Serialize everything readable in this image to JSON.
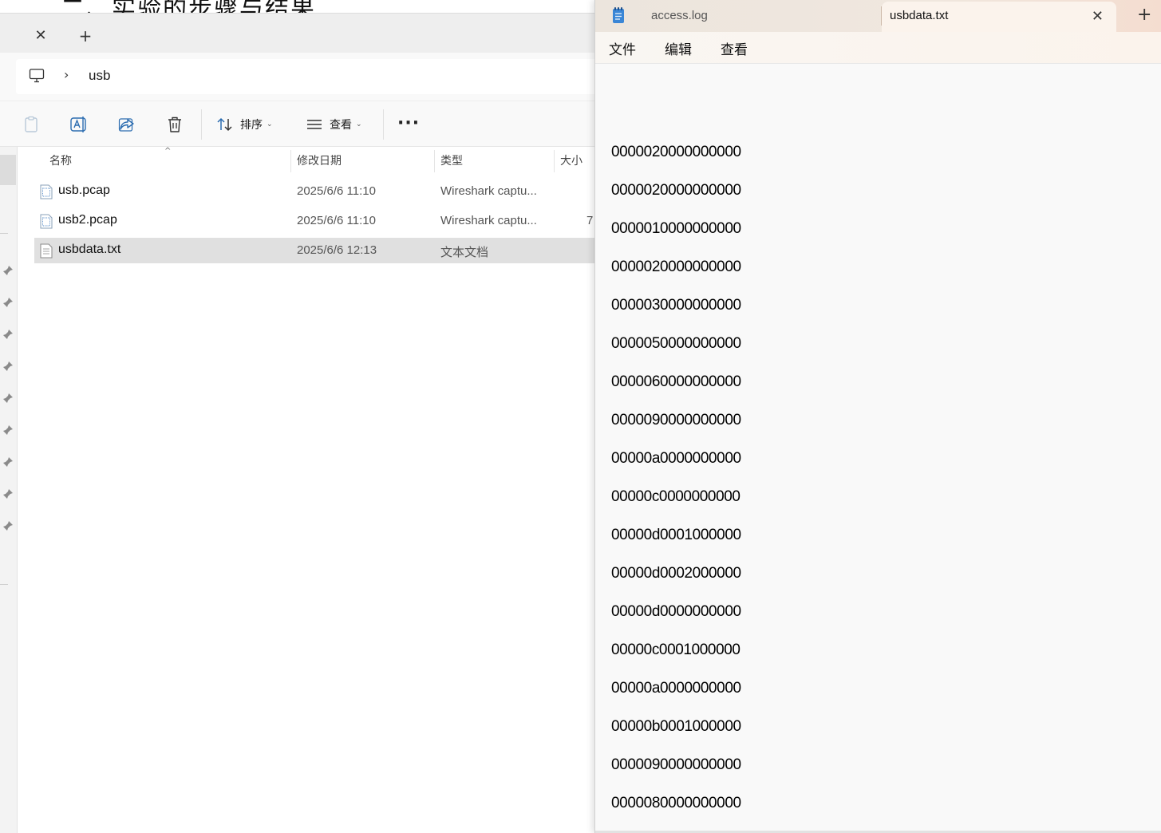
{
  "background_doc": {
    "heading_fragment": "二、实验的步骤与结果"
  },
  "explorer": {
    "tab_close_icon": "close-icon",
    "tab_new_icon": "plus-icon",
    "address": {
      "root_icon": "computer-icon",
      "separator": "›",
      "path_segment": "usb"
    },
    "toolbar": {
      "sort_label": "排序",
      "view_label": "查看",
      "more_label": "···",
      "icons": [
        "paste-icon",
        "rename-icon",
        "share-icon",
        "delete-icon",
        "sort-icon",
        "view-icon",
        "more-icon"
      ]
    },
    "columns": {
      "name": "名称",
      "date": "修改日期",
      "type": "类型",
      "size": "大小"
    },
    "files": [
      {
        "name": "usb.pcap",
        "date": "2025/6/6 11:10",
        "type": "Wireshark captu...",
        "size": "",
        "icon": "pcap-file-icon",
        "selected": false
      },
      {
        "name": "usb2.pcap",
        "date": "2025/6/6 11:10",
        "type": "Wireshark captu...",
        "size": "7",
        "icon": "pcap-file-icon",
        "selected": false
      },
      {
        "name": "usbdata.txt",
        "date": "2025/6/6 12:13",
        "type": "文本文档",
        "size": "",
        "icon": "text-file-icon",
        "selected": true
      }
    ]
  },
  "notepad": {
    "tabs": [
      {
        "label": "access.log",
        "active": false
      },
      {
        "label": "usbdata.txt",
        "active": true
      }
    ],
    "new_tab_label": "+",
    "menu": [
      "文件",
      "编辑",
      "查看"
    ],
    "lines": [
      "0000020000000000",
      "0000020000000000",
      "0000010000000000",
      "0000020000000000",
      "0000030000000000",
      "0000050000000000",
      "0000060000000000",
      "0000090000000000",
      "00000a0000000000",
      "00000c0000000000",
      "00000d0001000000",
      "00000d0002000000",
      "00000d0000000000",
      "00000c0001000000",
      "00000a0000000000",
      "00000b0001000000",
      "0000090000000000",
      "0000080000000000"
    ]
  }
}
